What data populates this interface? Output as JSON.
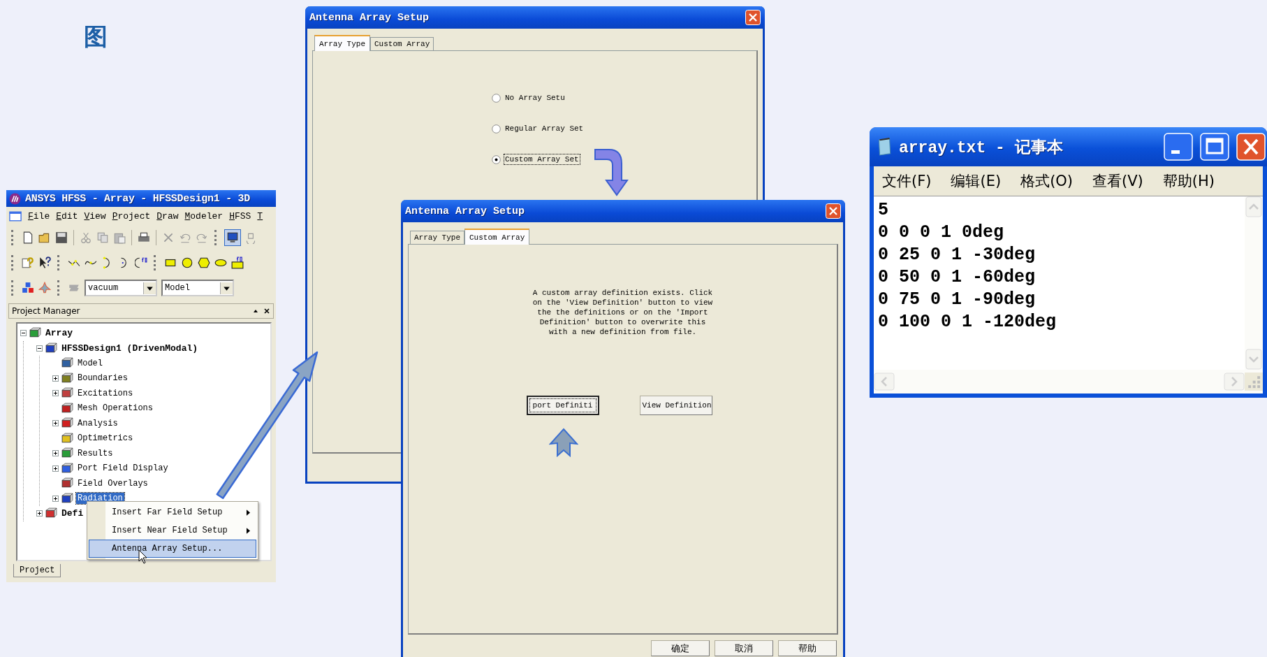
{
  "heading": "图",
  "hfss": {
    "title": "ANSYS HFSS - Array - HFSSDesign1 - 3D",
    "menu": [
      "File",
      "Edit",
      "View",
      "Project",
      "Draw",
      "Modeler",
      "HFSS",
      "T"
    ],
    "material": "vacuum",
    "mode": "Model",
    "panel_title": "Project Manager",
    "tree": [
      {
        "label": "Array",
        "kind": "minus",
        "selected": false,
        "children": [
          {
            "label": "HFSSDesign1 (DrivenModal)",
            "kind": "minus",
            "selected": false,
            "children": [
              {
                "label": "Model",
                "kind": "leaf",
                "selected": false
              },
              {
                "label": "Boundaries",
                "kind": "plus",
                "selected": false
              },
              {
                "label": "Excitations",
                "kind": "plus",
                "selected": false
              },
              {
                "label": "Mesh Operations",
                "kind": "leaf",
                "selected": false
              },
              {
                "label": "Analysis",
                "kind": "plus",
                "selected": false
              },
              {
                "label": "Optimetrics",
                "kind": "leaf",
                "selected": false
              },
              {
                "label": "Results",
                "kind": "plus",
                "selected": false
              },
              {
                "label": "Port Field Display",
                "kind": "plus",
                "selected": false
              },
              {
                "label": "Field Overlays",
                "kind": "leaf",
                "selected": false
              },
              {
                "label": "Radiation",
                "kind": "plus",
                "selected": true
              }
            ]
          },
          {
            "label": "Defi",
            "kind": "plus",
            "selected": false
          }
        ]
      }
    ],
    "context_menu": [
      {
        "label": "Insert Far Field Setup",
        "submenu": true,
        "selected": false
      },
      {
        "label": "Insert Near Field Setup",
        "submenu": true,
        "selected": false
      },
      {
        "label": "Antenna Array Setup...",
        "submenu": false,
        "selected": true
      }
    ],
    "bottom_tab": "Project"
  },
  "array_type_dialog": {
    "title": "Antenna Array Setup",
    "tabs": [
      {
        "label": "Array Type",
        "selected": true
      },
      {
        "label": "Custom Array",
        "selected": false
      }
    ],
    "options": [
      {
        "label": "No Array Setu",
        "selected": false
      },
      {
        "label": "Regular Array Set",
        "selected": false
      },
      {
        "label": "Custom Array Set",
        "selected": true
      }
    ]
  },
  "custom_array_dialog": {
    "title": "Antenna Array Setup",
    "tabs": [
      {
        "label": "Array Type",
        "selected": false
      },
      {
        "label": "Custom Array",
        "selected": true
      }
    ],
    "message": [
      "A custom array definition exists. Click",
      "on the 'View Definition' button to view",
      "the the definitions or on the 'Import",
      "Definition' button to overwrite this",
      "with a new definition from file."
    ],
    "actions": [
      "port Definiti",
      "View Definition"
    ],
    "footer": [
      "确定",
      "取消",
      "帮助"
    ]
  },
  "notepad": {
    "title": "array.txt - 记事本",
    "menu": [
      "文件(F)",
      "编辑(E)",
      "格式(O)",
      "查看(V)",
      "帮助(H)"
    ],
    "lines": [
      "5",
      "0 0 0 1 0deg",
      "0 25 0 1 -30deg",
      "0 50 0 1 -60deg",
      "0 75 0 1 -90deg",
      "0 100 0 1 -120deg"
    ]
  }
}
